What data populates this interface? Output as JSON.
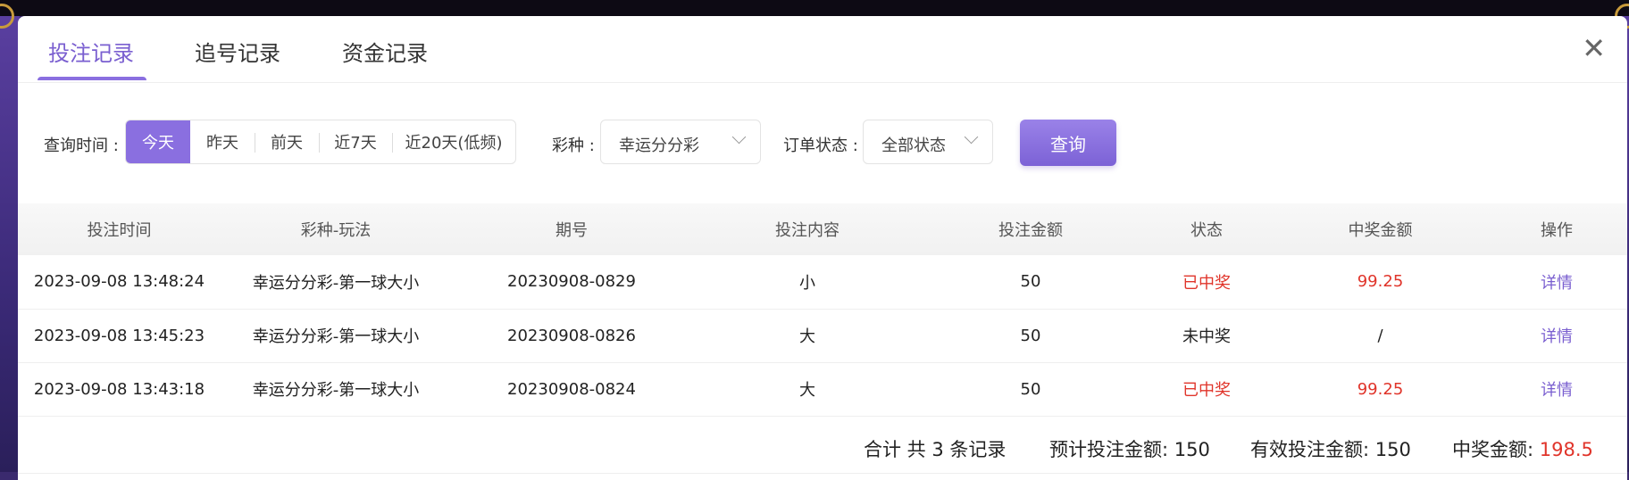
{
  "tabs": [
    {
      "label": "投注记录",
      "active": true
    },
    {
      "label": "追号记录",
      "active": false
    },
    {
      "label": "资金记录",
      "active": false
    }
  ],
  "close_glyph": "✕",
  "filters": {
    "time_label": "查询时间 :",
    "time_options": [
      "今天",
      "昨天",
      "前天",
      "近7天",
      "近20天(低频)"
    ],
    "time_selected": "今天",
    "lottery_label": "彩种 :",
    "lottery_value": "幸运分分彩",
    "status_label": "订单状态 :",
    "status_value": "全部状态",
    "query_button": "查询"
  },
  "table": {
    "columns": [
      "投注时间",
      "彩种-玩法",
      "期号",
      "投注内容",
      "投注金额",
      "状态",
      "中奖金额",
      "操作"
    ],
    "rows": [
      {
        "time": "2023-09-08 13:48:24",
        "game": "幸运分分彩-第一球大小",
        "issue": "20230908-0829",
        "content": "小",
        "amount": "50",
        "status": "已中奖",
        "prize": "99.25",
        "action": "详情",
        "won": true
      },
      {
        "time": "2023-09-08 13:45:23",
        "game": "幸运分分彩-第一球大小",
        "issue": "20230908-0826",
        "content": "大",
        "amount": "50",
        "status": "未中奖",
        "prize": "/",
        "action": "详情",
        "won": false
      },
      {
        "time": "2023-09-08 13:43:18",
        "game": "幸运分分彩-第一球大小",
        "issue": "20230908-0824",
        "content": "大",
        "amount": "50",
        "status": "已中奖",
        "prize": "99.25",
        "action": "详情",
        "won": true
      }
    ]
  },
  "summary": {
    "count_text": "合计 共 3 条记录",
    "expected_label": "预计投注金额:",
    "expected_value": "150",
    "valid_label": "有效投注金额:",
    "valid_value": "150",
    "prize_label": "中奖金额:",
    "prize_value": "198.5"
  },
  "colors": {
    "accent": "#8a6fe0",
    "win": "#e0342a"
  }
}
